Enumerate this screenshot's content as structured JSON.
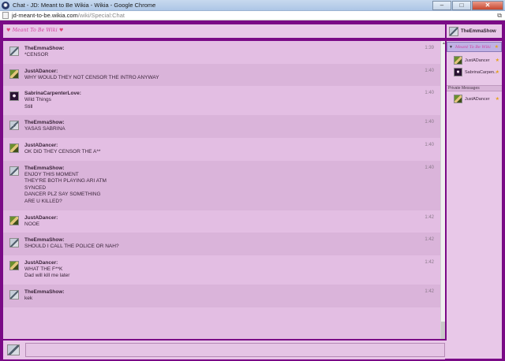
{
  "window": {
    "title": "Chat - JD: Meant to Be Wikia - Wikia - Google Chrome",
    "controls": {
      "minimize": "–",
      "maximize": "□",
      "close": "✕"
    }
  },
  "address": {
    "domain": "jd-meant-to-be.wikia.com",
    "path": "/wiki/Special:Chat"
  },
  "header": {
    "logo": "Meant To Be Wiki"
  },
  "current_user": {
    "name": "TheEmmaShow"
  },
  "messages": [
    {
      "user": "TheEmmaShow",
      "time": "1:39",
      "lines": [
        "*CENSOR"
      ],
      "avatar": "emma"
    },
    {
      "user": "JustADancer",
      "time": "1:40",
      "lines": [
        "WHY WOULD THEY NOT CENSOR THE INTRO ANYWAY"
      ],
      "avatar": "dancer"
    },
    {
      "user": "SabrinaCarpenterLove",
      "time": "1:40",
      "lines": [
        "Wild Things",
        "Still"
      ],
      "avatar": "sabrina"
    },
    {
      "user": "TheEmmaShow",
      "time": "1:40",
      "lines": [
        "YASAS SABRINA"
      ],
      "avatar": "emma"
    },
    {
      "user": "JustADancer",
      "time": "1:40",
      "lines": [
        "OK DID THEY CENSOR THE A**"
      ],
      "avatar": "dancer"
    },
    {
      "user": "TheEmmaShow",
      "time": "1:40",
      "lines": [
        "ENJOY THIS MOMENT",
        "THEY'RE BOTH PLAYING ARI ATM",
        "SYNCED",
        "DANCER PLZ SAY SOMETHING",
        "ARE U KILLED?"
      ],
      "avatar": "emma"
    },
    {
      "user": "JustADancer",
      "time": "1:42",
      "lines": [
        "NOOE"
      ],
      "avatar": "dancer"
    },
    {
      "user": "TheEmmaShow",
      "time": "1:42",
      "lines": [
        "SHOULD I CALL THE POLICE OR NAH?"
      ],
      "avatar": "emma"
    },
    {
      "user": "JustADancer",
      "time": "1:42",
      "lines": [
        "WHAT THE F**K",
        "Dad will kill me later"
      ],
      "avatar": "dancer"
    },
    {
      "user": "TheEmmaShow",
      "time": "1:42",
      "lines": [
        "kek"
      ],
      "avatar": "emma"
    }
  ],
  "sidebar": {
    "room_logo": "Meant To Be Wiki",
    "users": [
      {
        "name": "JustADancer",
        "avatar": "dancer"
      },
      {
        "name": "SabrinaCarpen...",
        "avatar": "sabrina"
      }
    ],
    "private_messages_label": "Private Messages",
    "private_users": [
      {
        "name": "JustADancer",
        "avatar": "dancer"
      }
    ]
  },
  "input": {
    "placeholder": ""
  }
}
